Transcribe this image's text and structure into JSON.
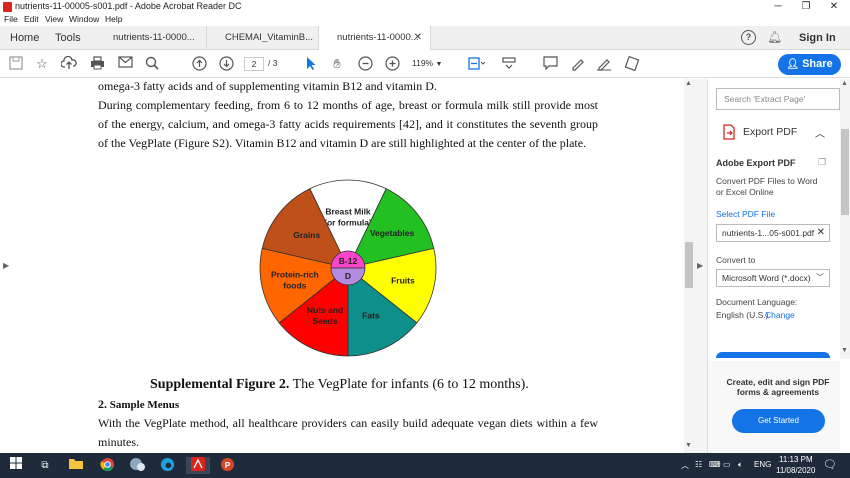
{
  "window": {
    "title": "nutrients-11-00005-s001.pdf - Adobe Acrobat Reader DC"
  },
  "menu": [
    "File",
    "Edit",
    "View",
    "Window",
    "Help"
  ],
  "nav": {
    "home": "Home",
    "tools": "Tools"
  },
  "tabs": [
    {
      "label": "nutrients-11-0000..."
    },
    {
      "label": "CHEMAI_VitaminB..."
    },
    {
      "label": "nutrients-11-0000...",
      "active": true
    }
  ],
  "header_right": {
    "help": "?",
    "signin": "Sign In"
  },
  "toolbar": {
    "page_current": "2",
    "page_total": "/ 3",
    "zoom": "119%",
    "share": "Share"
  },
  "doc": {
    "para_top": "omega-3 fatty acids and of supplementing vitamin B12 and vitamin D.",
    "para_main": "During complementary feeding, from 6 to 12 months of age, breast or formula milk still provide most of the energy, calcium, and omega-3 fatty acids requirements [42], and it constitutes the seventh group of the VegPlate (Figure S2). Vitamin B12 and vitamin D are still highlighted at the center of the plate.",
    "figure_label": "Supplemental Figure 2.",
    "figure_caption": " The VegPlate for infants (6 to 12 months).",
    "section_num": "2.",
    "section_title": " Sample Menus",
    "para_bottom": "With the VegPlate method, all healthcare providers can easily build adequate vegan diets within a few minutes."
  },
  "plate": {
    "segments": [
      {
        "label": "Breast Milk\n(or formula)",
        "color": "#ffffff",
        "text_color": "#222222"
      },
      {
        "label": "Vegetables",
        "color": "#22c021",
        "text_color": "#222222"
      },
      {
        "label": "Fruits",
        "color": "#ffff00",
        "text_color": "#222222"
      },
      {
        "label": "Fats",
        "color": "#0e8f8a",
        "text_color": "#222222"
      },
      {
        "label": "Nuts and\nSeeds",
        "color": "#ff0000",
        "text_color": "#222222"
      },
      {
        "label": "Protein-rich\nfoods",
        "color": "#ff6600",
        "text_color": "#222222"
      },
      {
        "label": "Grains",
        "color": "#c0501a",
        "text_color": "#222222"
      }
    ],
    "center_top": "B-12",
    "center_bottom": "D",
    "center_top_color": "#ff44cc",
    "center_bottom_color": "#b48ae0"
  },
  "panel": {
    "search_placeholder": "Search 'Extract Page'",
    "export_title": "Export PDF",
    "section_heading": "Adobe Export PDF",
    "description": "Convert PDF Files to Word or Excel Online",
    "select_label": "Select PDF File",
    "file_name": "nutrients-1...05-s001.pdf",
    "convert_to": "Convert to",
    "format": "Microsoft Word (*.docx)",
    "doc_language": "Document Language:",
    "language": "English (U.S.)",
    "change": "Change",
    "promo": "Create, edit and sign PDF forms & agreements",
    "get_started": "Get Started"
  },
  "taskbar": {
    "lang": "ENG",
    "time": "11:13 PM",
    "date": "11/08/2020"
  },
  "colors": {
    "accent": "#1473e6",
    "taskbar": "#1f2b3a"
  }
}
